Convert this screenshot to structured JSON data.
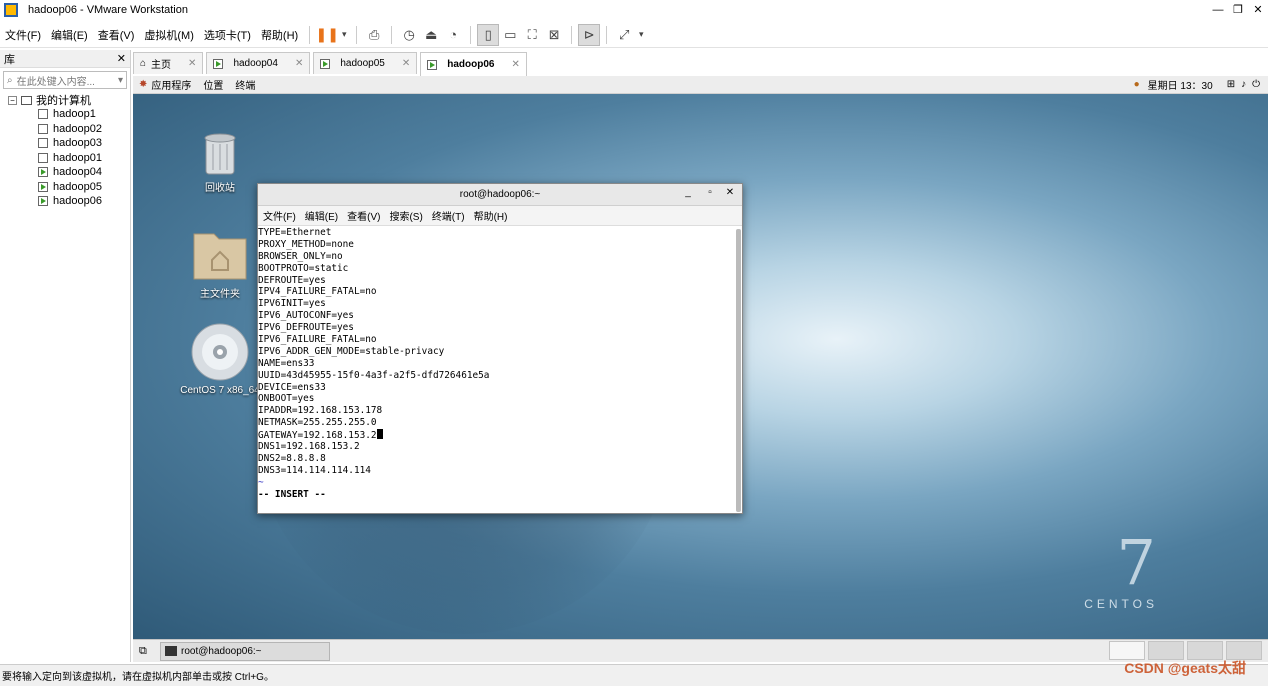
{
  "window": {
    "title": "hadoop06 - VMware Workstation",
    "minimize": "—",
    "restore": "❐",
    "close": "✕"
  },
  "menu": [
    "文件(F)",
    "编辑(E)",
    "查看(V)",
    "虚拟机(M)",
    "选项卡(T)",
    "帮助(H)"
  ],
  "library": {
    "title": "库",
    "close": "✕",
    "search_placeholder": "在此处键入内容...",
    "root": "我的计算机",
    "vms": [
      {
        "name": "hadoop1",
        "running": false
      },
      {
        "name": "hadoop02",
        "running": false
      },
      {
        "name": "hadoop03",
        "running": false
      },
      {
        "name": "hadoop01",
        "running": false
      },
      {
        "name": "hadoop04",
        "running": true
      },
      {
        "name": "hadoop05",
        "running": true
      },
      {
        "name": "hadoop06",
        "running": true
      }
    ]
  },
  "tabs": [
    {
      "label": "主页",
      "active": false
    },
    {
      "label": "hadoop04",
      "active": false
    },
    {
      "label": "hadoop05",
      "active": false
    },
    {
      "label": "hadoop06",
      "active": true
    }
  ],
  "gnome": {
    "applications": "应用程序",
    "places": "位置",
    "terminal": "终端",
    "clock": "星期日 13：30"
  },
  "desktop": {
    "icons": [
      "回收站",
      "主文件夹",
      "CentOS 7 x86_64"
    ],
    "brand_number": "7",
    "brand_word": "CENTOS"
  },
  "terminal": {
    "title": "root@hadoop06:~",
    "menu": [
      "文件(F)",
      "编辑(E)",
      "查看(V)",
      "搜索(S)",
      "终端(T)",
      "帮助(H)"
    ],
    "lines": [
      "TYPE=Ethernet",
      "PROXY_METHOD=none",
      "BROWSER_ONLY=no",
      "BOOTPROTO=static",
      "DEFROUTE=yes",
      "IPV4_FAILURE_FATAL=no",
      "IPV6INIT=yes",
      "IPV6_AUTOCONF=yes",
      "IPV6_DEFROUTE=yes",
      "IPV6_FAILURE_FATAL=no",
      "IPV6_ADDR_GEN_MODE=stable-privacy",
      "NAME=ens33",
      "UUID=43d45955-15f0-4a3f-a2f5-dfd726461e5a",
      "DEVICE=ens33",
      "ONBOOT=yes",
      "IPADDR=192.168.153.178",
      "NETMASK=255.255.255.0",
      "GATEWAY=192.168.153.2",
      "DNS1=192.168.153.2",
      "DNS2=8.8.8.8",
      "DNS3=114.114.114.114"
    ],
    "tilde": "~",
    "mode": "-- INSERT --"
  },
  "taskbar": {
    "item": "root@hadoop06:~"
  },
  "status": {
    "hint": "要将输入定向到该虚拟机，请在虚拟机内部单击或按 Ctrl+G。",
    "watermark": "CSDN @geats太甜"
  }
}
